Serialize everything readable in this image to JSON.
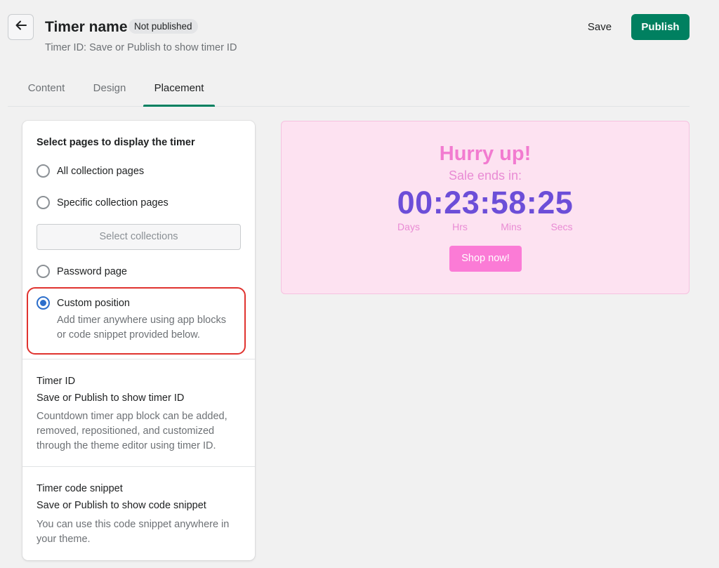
{
  "header": {
    "title": "Timer name",
    "status_badge": "Not published",
    "subtitle": "Timer ID: Save or Publish to show timer ID",
    "save_label": "Save",
    "publish_label": "Publish",
    "back_icon": "arrow-left-icon"
  },
  "tabs": [
    {
      "label": "Content",
      "active": false
    },
    {
      "label": "Design",
      "active": false
    },
    {
      "label": "Placement",
      "active": true
    }
  ],
  "placement": {
    "section_title": "Select pages to display the timer",
    "options": [
      {
        "label": "All collection pages",
        "checked": false
      },
      {
        "label": "Specific collection pages",
        "checked": false
      },
      {
        "label": "Password page",
        "checked": false
      },
      {
        "label": "Custom position",
        "checked": true
      }
    ],
    "select_collections_label": "Select collections",
    "custom_help_line1": "Add timer anywhere using app blocks",
    "custom_help_line2": "or code snippet provided below."
  },
  "timer_id": {
    "title": "Timer ID",
    "value": "Save or Publish to show timer ID",
    "help_line1": "Countdown timer app block can be added,",
    "help_line2": "removed, repositioned, and customized",
    "help_line3": "through the theme editor using timer ID."
  },
  "code_snippet": {
    "title": "Timer code snippet",
    "value": "Save or Publish to show code snippet",
    "help_line1": "You can use this code snippet anywhere in",
    "help_line2": "your theme."
  },
  "preview": {
    "heading": "Hurry up!",
    "subheading": "Sale ends in:",
    "countdown": "00:23:58:25",
    "units": [
      "Days",
      "Hrs",
      "Mins",
      "Secs"
    ],
    "button_label": "Shop now!",
    "colors": {
      "background": "#fde2f1",
      "heading": "#f27bd0",
      "digits": "#6c4ed8",
      "button": "#fb7bd6"
    }
  },
  "colors": {
    "primary": "#008060",
    "radio_selected": "#2c6ecb",
    "highlight": "#e0332f"
  }
}
